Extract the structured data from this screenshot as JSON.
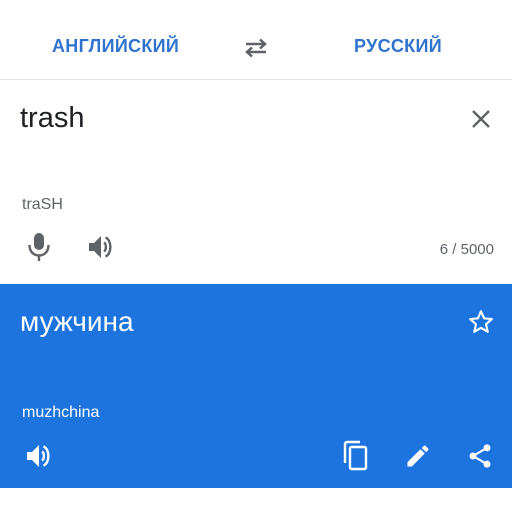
{
  "languages": {
    "source": "АНГЛИЙСКИЙ",
    "target": "РУССКИЙ"
  },
  "input": {
    "text": "trash",
    "transliteration": "traSH",
    "char_count": "6 / 5000"
  },
  "output": {
    "text": "мужчина",
    "transliteration": "muzhchina"
  },
  "icons": {
    "swap": "swap-horiz-icon",
    "clear": "close-icon",
    "mic": "microphone-icon",
    "speaker": "volume-icon",
    "star": "star-outline-icon",
    "copy": "copy-icon",
    "edit": "pencil-icon",
    "share": "share-icon"
  },
  "colors": {
    "accent": "#2f73cf",
    "output_bg": "#1e74df",
    "text_primary": "#202124",
    "text_secondary": "#5f6368"
  }
}
